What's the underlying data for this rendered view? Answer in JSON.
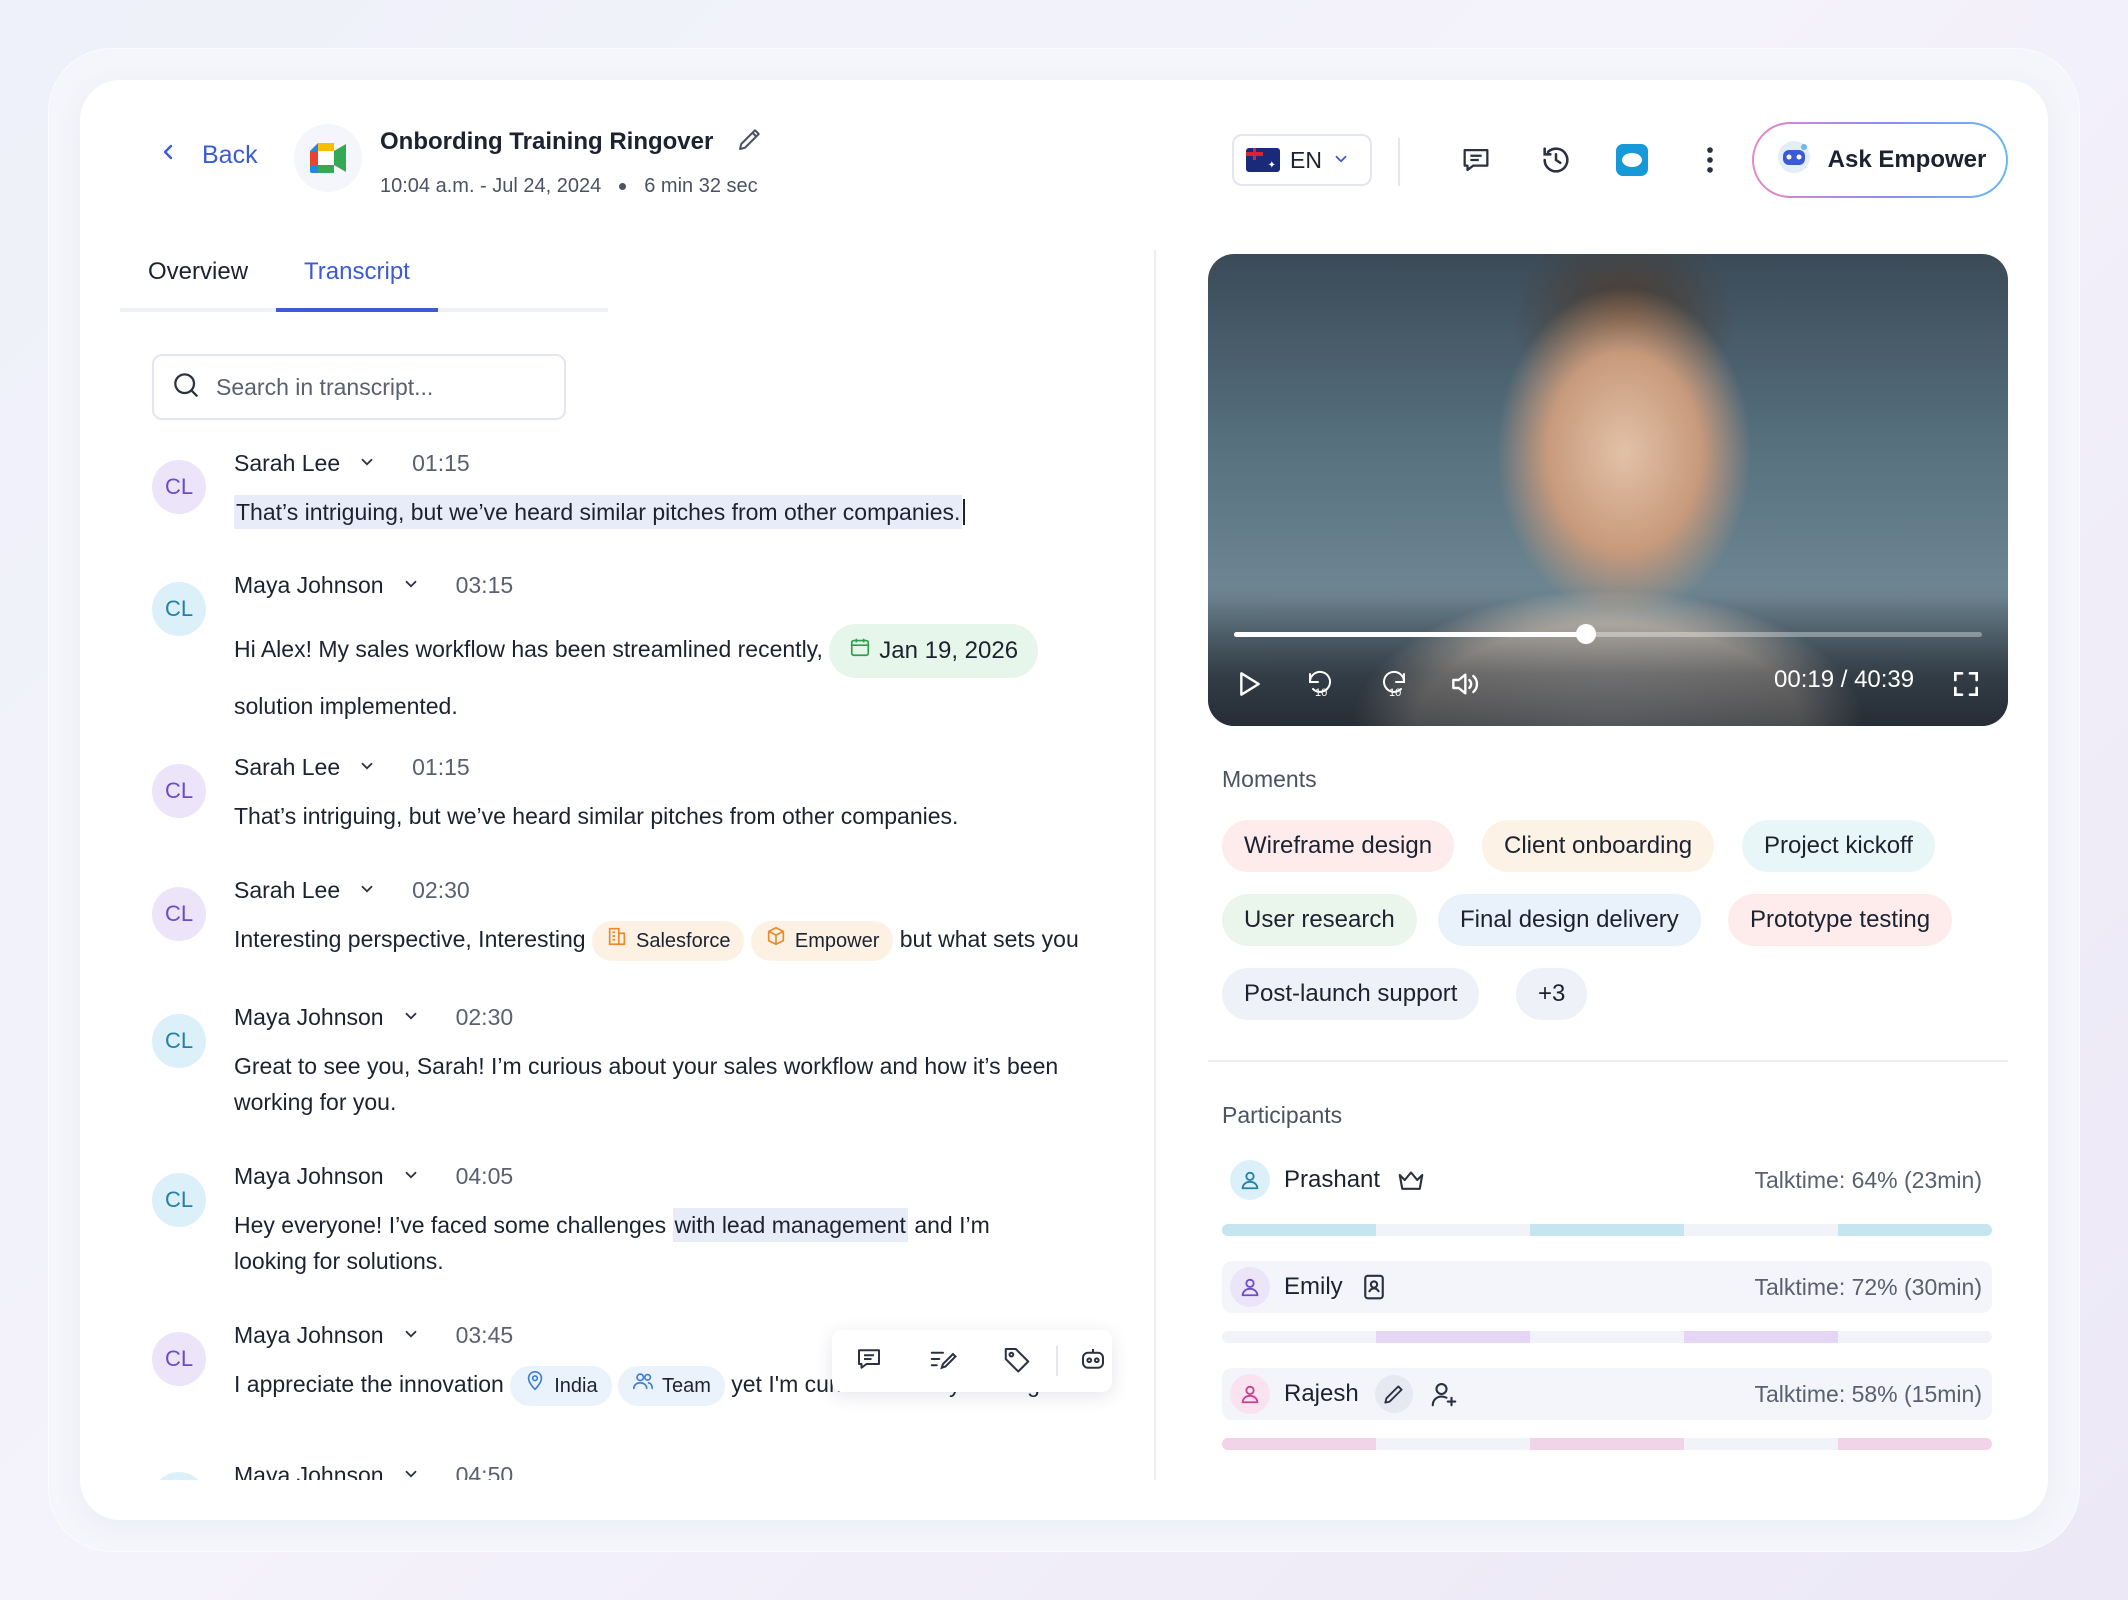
{
  "header": {
    "back_label": "Back",
    "title": "Onbording Training Ringover",
    "datetime": "10:04 a.m. - Jul 24, 2024",
    "duration": "6 min 32 sec",
    "language": "EN",
    "ask_label": "Ask Empower",
    "icons": [
      "chevron-left-icon",
      "google-meet-icon",
      "pencil-icon",
      "australia-flag-icon",
      "chat-icon",
      "history-icon",
      "salesforce-icon",
      "more-vertical-icon",
      "empower-bot-icon"
    ]
  },
  "tabs": [
    {
      "label": "Overview",
      "active": false
    },
    {
      "label": "Transcript",
      "active": true
    }
  ],
  "search": {
    "placeholder": "Search in transcript..."
  },
  "transcript": [
    {
      "initials": "CL",
      "speaker": "Sarah Lee",
      "time": "01:15",
      "text": "That’s intriguing, but we’ve heard similar pitches from other companies."
    },
    {
      "initials": "CL",
      "speaker": "Maya Johnson",
      "time": "03:15",
      "text_before": "Hi Alex! My sales workflow has been  streamlined recently,",
      "date_chip": "Jan 19, 2026",
      "text_after": "solution implemented."
    },
    {
      "initials": "CL",
      "speaker": "Sarah Lee",
      "time": "01:15",
      "text": "That’s intriguing, but we’ve heard similar pitches from other companies."
    },
    {
      "initials": "CL",
      "speaker": "Sarah Lee",
      "time": "02:30",
      "text_before": "Interesting perspective,  Interesting",
      "chip1": "Salesforce",
      "chip2": "Empower",
      "text_after": "but what sets you"
    },
    {
      "initials": "CL",
      "speaker": "Maya Johnson",
      "time": "02:30",
      "text": "Great to see you, Sarah! I’m curious about your sales workflow and how it’s been working for you."
    },
    {
      "initials": "CL",
      "speaker": "Maya Johnson",
      "time": "04:05",
      "text_before": "Hey everyone! I’ve faced some challenges ",
      "highlight": "with lead management",
      "text_after": " and I’m looking for solutions."
    },
    {
      "initials": "CL",
      "speaker": "Maya Johnson",
      "time": "03:45",
      "text_before": "I appreciate the innovation",
      "chip1": "India",
      "chip2": "Team",
      "text_after": "yet I'm curious about your target"
    },
    {
      "initials": "CL",
      "speaker": "Maya Johnson",
      "time": "04:50"
    }
  ],
  "selection_toolbar": [
    "comment-icon",
    "edit-note-icon",
    "tag-icon",
    "ai-assistant-icon"
  ],
  "video": {
    "time": "00:19 / 40:39",
    "progress": 0.47,
    "controls": [
      "play-icon",
      "rewind-10-icon",
      "forward-10-icon",
      "volume-icon",
      "fullscreen-icon"
    ],
    "skip_label": "10"
  },
  "moments": {
    "label": "Moments",
    "items": [
      {
        "label": "Wireframe design",
        "color": "#fdeceb"
      },
      {
        "label": "Client onboarding",
        "color": "#fdf2e6"
      },
      {
        "label": "Project kickoff",
        "color": "#e9f6f8"
      },
      {
        "label": "User research",
        "color": "#eaf6ec"
      },
      {
        "label": "Final design delivery",
        "color": "#e9f2fb"
      },
      {
        "label": "Prototype testing",
        "color": "#fdeceb"
      },
      {
        "label": "Post-launch support",
        "color": "#eef1f7"
      },
      {
        "label": "+3",
        "color": "#eef1f7"
      }
    ]
  },
  "participants": {
    "label": "Participants",
    "items": [
      {
        "name": "Prashant",
        "talktime": "Talktime: 64% (23min)",
        "color": "#c5e6f1",
        "icon": "crown-icon"
      },
      {
        "name": "Emily",
        "talktime": "Talktime: 72% (30min)",
        "color": "#e5d6f5",
        "icon": "contact-book-icon"
      },
      {
        "name": "Rajesh",
        "talktime": "Talktime: 58% (15min)",
        "color": "#f3d3e8",
        "icon": "pencil-icon"
      }
    ]
  }
}
